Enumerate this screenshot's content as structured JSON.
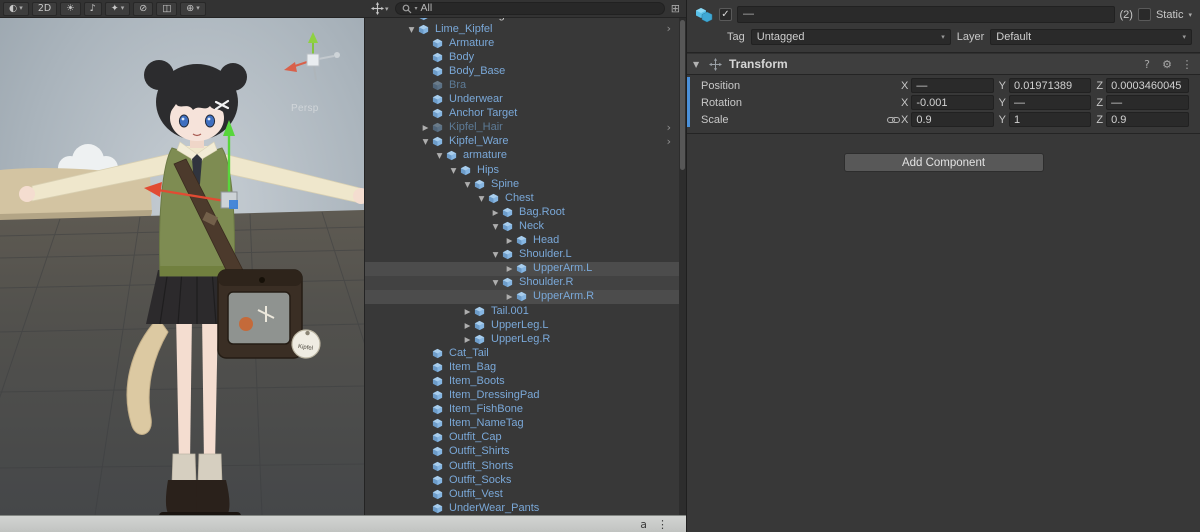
{
  "scene": {
    "persp_label": "Persp",
    "bag_tag_text": "Kipfel"
  },
  "scene_toolbar": {
    "buttons": [
      {
        "name": "shading-mode-button",
        "glyph": "◐",
        "dropdown": true
      },
      {
        "name": "2d-toggle-button",
        "glyph": "2D",
        "dropdown": false
      },
      {
        "name": "scene-lighting-button",
        "glyph": "☀",
        "dropdown": false
      },
      {
        "name": "scene-audio-button",
        "glyph": "♪",
        "dropdown": false
      },
      {
        "name": "effects-button",
        "glyph": "✦",
        "dropdown": true
      },
      {
        "name": "scene-visibility-button",
        "glyph": "⊘",
        "dropdown": false
      },
      {
        "name": "camera-settings-button",
        "glyph": "◫",
        "dropdown": false
      },
      {
        "name": "gizmos-button",
        "glyph": "⊕",
        "dropdown": true
      }
    ]
  },
  "hierarchy": {
    "create_caret": "▾",
    "search_value": "All",
    "clipped_item": "Directional Light",
    "items": [
      {
        "label": "Lime_Kipfel",
        "indent": 0,
        "arrow": "expanded",
        "nav": true
      },
      {
        "label": "Armature",
        "indent": 1
      },
      {
        "label": "Body",
        "indent": 1
      },
      {
        "label": "Body_Base",
        "indent": 1
      },
      {
        "label": "Bra",
        "indent": 1,
        "disabled": true
      },
      {
        "label": "Underwear",
        "indent": 1
      },
      {
        "label": "Anchor Target",
        "indent": 1
      },
      {
        "label": "Kipfel_Hair",
        "indent": 1,
        "arrow": "collapsed",
        "disabled": true,
        "nav": true
      },
      {
        "label": "Kipfel_Ware",
        "indent": 1,
        "arrow": "expanded",
        "nav": true
      },
      {
        "label": "armature",
        "indent": 2,
        "arrow": "expanded"
      },
      {
        "label": "Hips",
        "indent": 3,
        "arrow": "expanded"
      },
      {
        "label": "Spine",
        "indent": 4,
        "arrow": "expanded"
      },
      {
        "label": "Chest",
        "indent": 5,
        "arrow": "expanded"
      },
      {
        "label": "Bag.Root",
        "indent": 6,
        "arrow": "collapsed"
      },
      {
        "label": "Neck",
        "indent": 6,
        "arrow": "expanded"
      },
      {
        "label": "Head",
        "indent": 7,
        "arrow": "collapsed"
      },
      {
        "label": "Shoulder.L",
        "indent": 6,
        "arrow": "expanded"
      },
      {
        "label": "UpperArm.L",
        "indent": 7,
        "arrow": "collapsed",
        "selected": "primary"
      },
      {
        "label": "Shoulder.R",
        "indent": 6,
        "arrow": "expanded",
        "selected": "secondary"
      },
      {
        "label": "UpperArm.R",
        "indent": 7,
        "arrow": "collapsed",
        "selected": "primary"
      },
      {
        "label": "Tail.001",
        "indent": 4,
        "arrow": "collapsed"
      },
      {
        "label": "UpperLeg.L",
        "indent": 4,
        "arrow": "collapsed"
      },
      {
        "label": "UpperLeg.R",
        "indent": 4,
        "arrow": "collapsed"
      },
      {
        "label": "Cat_Tail",
        "indent": 1
      },
      {
        "label": "Item_Bag",
        "indent": 1
      },
      {
        "label": "Item_Boots",
        "indent": 1
      },
      {
        "label": "Item_DressingPad",
        "indent": 1
      },
      {
        "label": "Item_FishBone",
        "indent": 1
      },
      {
        "label": "Item_NameTag",
        "indent": 1
      },
      {
        "label": "Outfit_Cap",
        "indent": 1
      },
      {
        "label": "Outfit_Shirts",
        "indent": 1
      },
      {
        "label": "Outfit_Shorts",
        "indent": 1
      },
      {
        "label": "Outfit_Socks",
        "indent": 1
      },
      {
        "label": "Outfit_Vest",
        "indent": 1
      },
      {
        "label": "UnderWear_Pants",
        "indent": 1
      }
    ]
  },
  "statusbar": {
    "glyphs": [
      "a",
      "⋮"
    ]
  },
  "inspector": {
    "name_value": "—",
    "multi_count": "(2)",
    "static_label": "Static",
    "static_caret": "▾",
    "tag_label": "Tag",
    "tag_value": "Untagged",
    "layer_label": "Layer",
    "layer_value": "Default",
    "transform": {
      "title": "Transform",
      "axis_x": "X",
      "axis_y": "Y",
      "axis_z": "Z",
      "rows": [
        {
          "label": "Position",
          "x": "—",
          "y": "0.01971389",
          "z": "0.0003460045",
          "linked": false
        },
        {
          "label": "Rotation",
          "x": "-0.001",
          "y": "—",
          "z": "—",
          "linked": false
        },
        {
          "label": "Scale",
          "x": "0.9",
          "y": "1",
          "z": "0.9",
          "linked": true
        }
      ]
    },
    "add_component_label": "Add Component"
  }
}
